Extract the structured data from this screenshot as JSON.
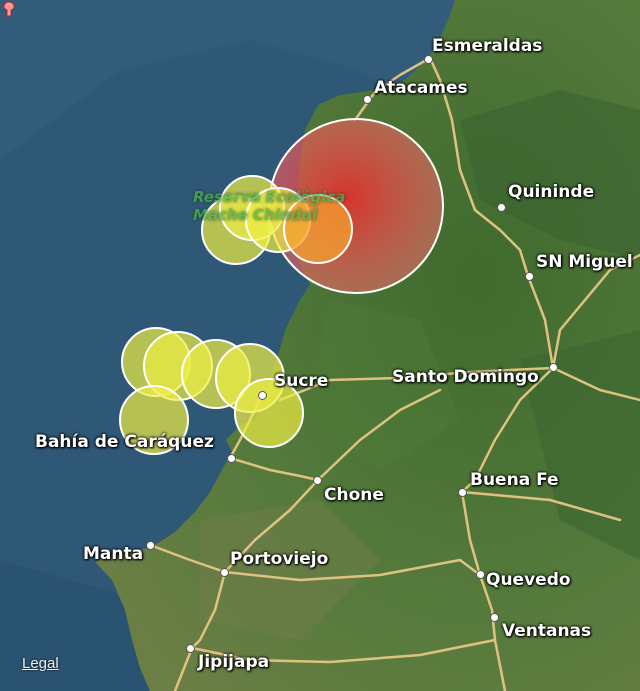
{
  "map": {
    "colors": {
      "ocean": "#2f5876",
      "land": "#4f6e3a",
      "road": "#e0c280",
      "mainshock_fill": "#e8403a",
      "aftershock_fill": "#eeee44",
      "orange_shock_fill": "#f5a030",
      "circle_stroke": "#ffffff"
    },
    "reserve_label": "Reserva Ecológica Mache Chindul",
    "mainshock_icon": "earthquake-pin-icon",
    "cities": [
      {
        "id": "esmeraldas",
        "name": "Esmeraldas"
      },
      {
        "id": "atacames",
        "name": "Atacames"
      },
      {
        "id": "quininde",
        "name": "Quininde"
      },
      {
        "id": "sn-miguel",
        "name": "SN Miguel"
      },
      {
        "id": "santo-domingo",
        "name": "Santo Domingo"
      },
      {
        "id": "sucre",
        "name": "Sucre"
      },
      {
        "id": "bahia",
        "name": "Bahía de Caráquez"
      },
      {
        "id": "chone",
        "name": "Chone"
      },
      {
        "id": "buena-fe",
        "name": "Buena Fe"
      },
      {
        "id": "manta",
        "name": "Manta"
      },
      {
        "id": "portoviejo",
        "name": "Portoviejo"
      },
      {
        "id": "quevedo",
        "name": "Quevedo"
      },
      {
        "id": "ventanas",
        "name": "Ventanas"
      },
      {
        "id": "jipijapa",
        "name": "Jipijapa"
      }
    ],
    "legal_link": "Legal"
  }
}
